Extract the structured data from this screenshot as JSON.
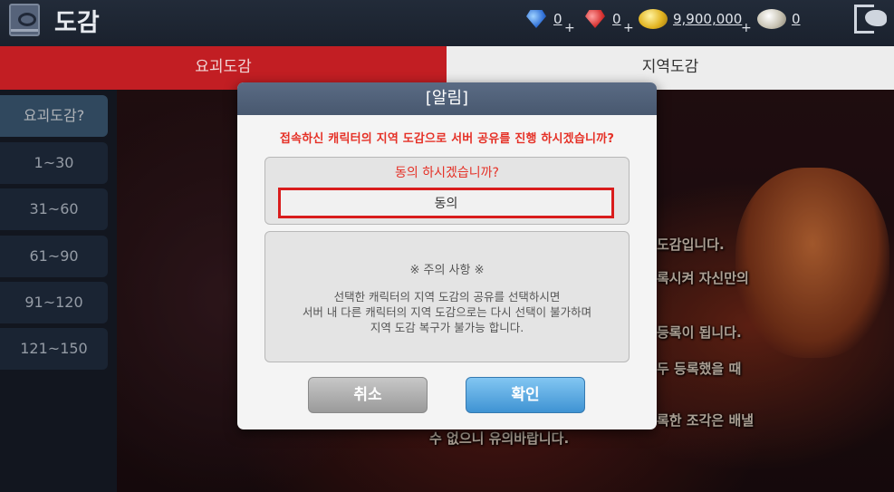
{
  "header": {
    "title": "도감",
    "icons": {
      "book": "book-eye-icon",
      "exit": "exit-door-icon"
    },
    "currencies": [
      {
        "icon": "blue-gem-icon",
        "value": "0",
        "plus": "+"
      },
      {
        "icon": "red-gem-icon",
        "value": "0",
        "plus": "+"
      },
      {
        "icon": "gold-coin-icon",
        "value": "9,900,000",
        "plus": "+"
      },
      {
        "icon": "silver-coin-icon",
        "value": "0"
      }
    ]
  },
  "tabs": [
    {
      "label": "요괴도감",
      "active": true
    },
    {
      "label": "지역도감",
      "active": false
    }
  ],
  "sidebar": {
    "items": [
      {
        "label": "요괴도감?",
        "active": true
      },
      {
        "label": "1~30"
      },
      {
        "label": "31~60"
      },
      {
        "label": "61~90"
      },
      {
        "label": "91~120"
      },
      {
        "label": "121~150"
      }
    ]
  },
  "background_text": [
    "도감입니다.",
    "록시켜 자신만의",
    "등록이 됩니다.",
    "두 등록했을 때",
    "록한 조각은 배낼",
    "수 없으니 유의바랍니다."
  ],
  "modal": {
    "title": "[알림]",
    "question": "접속하신 캐릭터의 지역 도감으로 서버 공유를 진행 하시겠습니까?",
    "confirm_prompt": "동의 하시겠습니까?",
    "confirm_input_value": "동의",
    "notice_title": "※ 주의 사항 ※",
    "notice_lines": [
      "선택한 캐릭터의 지역 도감의 공유를 선택하시면",
      "서버 내 다른 캐릭터의 지역 도감으로는 다시 선택이 불가하며",
      "지역 도감 복구가 불가능 합니다."
    ],
    "cancel_label": "취소",
    "ok_label": "확인"
  },
  "colors": {
    "active_tab": "#c21e23",
    "warning_text": "#e53026",
    "ok_button": "#3f93d3",
    "input_highlight": "#d91c1c"
  }
}
